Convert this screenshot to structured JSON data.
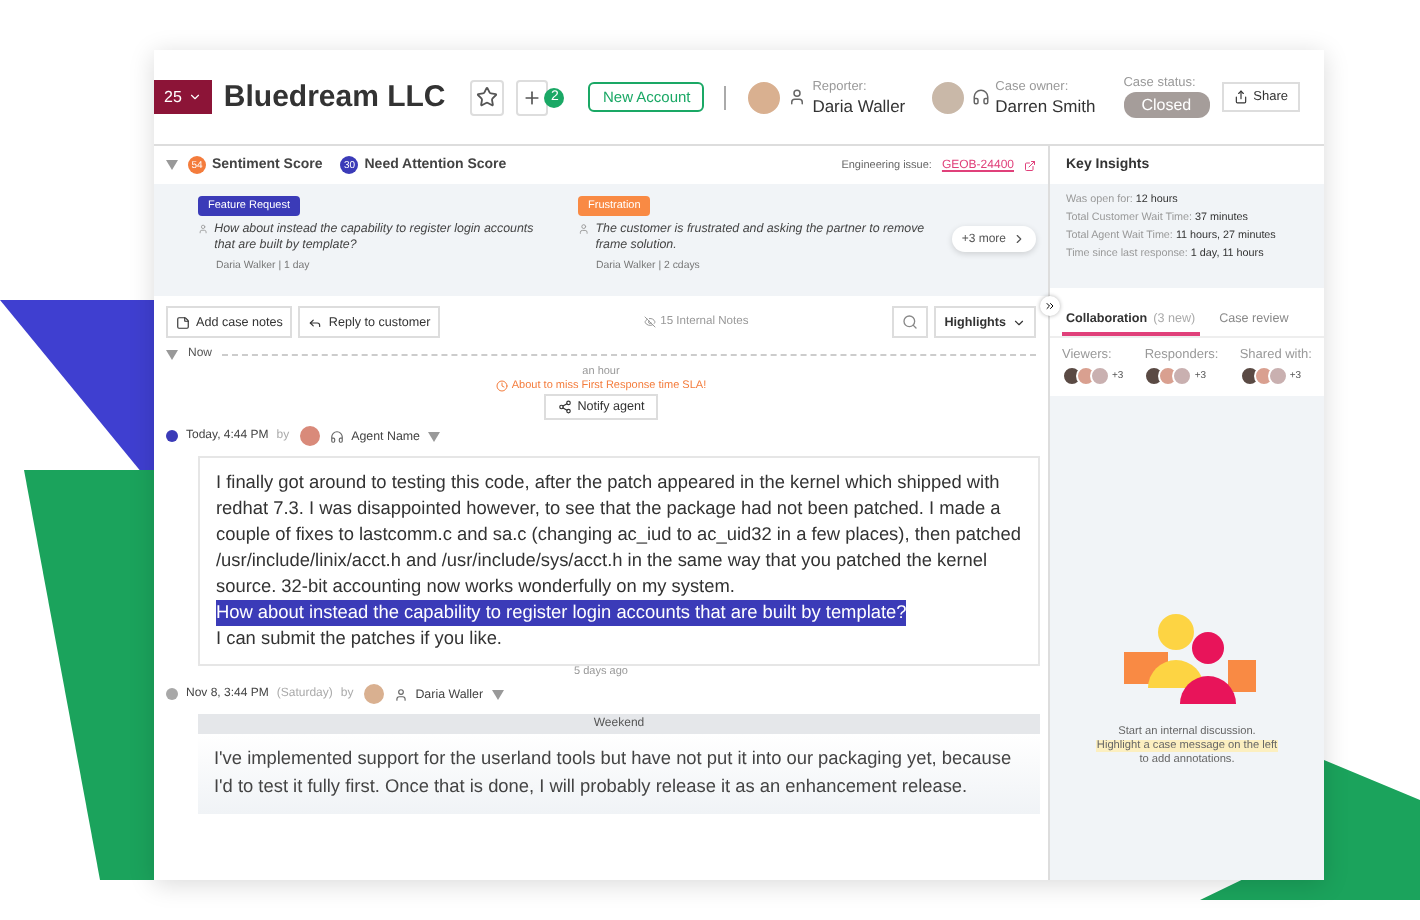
{
  "header": {
    "case_number": "25",
    "company": "Bluedream LLC",
    "linked_count": "2",
    "account_badge": "New Account",
    "reporter": {
      "label": "Reporter:",
      "name": "Daria Waller"
    },
    "owner": {
      "label": "Case owner:",
      "name": "Darren Smith"
    },
    "status": {
      "label": "Case status:",
      "value": "Closed"
    },
    "share": "Share"
  },
  "scores": [
    {
      "value": "54",
      "label": "Sentiment Score",
      "color": "#f47c3c"
    },
    {
      "value": "30",
      "label": "Need Attention Score",
      "color": "#3b3bb8"
    }
  ],
  "engineering_issue": {
    "label": "Engineering issue:",
    "link": "GEOB-24400"
  },
  "highlights": [
    {
      "tag": "Feature Request",
      "color": "#3b3bb8",
      "text": "How about instead the capability to register login accounts that are built by template?",
      "meta": "Daria Walker | 1 day"
    },
    {
      "tag": "Frustration",
      "color": "#f98a44",
      "text": "The customer is frustrated and asking the partner to remove frame solution.",
      "meta": "Daria Walker | 2 cdays"
    }
  ],
  "more": "+3 more",
  "toolbar": {
    "add_notes": "Add case notes",
    "reply": "Reply to customer",
    "internal_notes": "15 Internal Notes",
    "filter": "Highlights"
  },
  "timeline": {
    "now": "Now",
    "gap": "an hour",
    "sla": "About to miss First Response time SLA!",
    "notify": "Notify agent"
  },
  "messages": [
    {
      "time": "Today, 4:44 PM",
      "by": "by",
      "author": "Agent Name",
      "kind": "agent",
      "color": "#3b3bb8",
      "paragraphs": [
        {
          "text": "I finally got around to testing this code, after the patch appeared in the kernel which shipped with redhat 7.3. I was disappointed however, to see that the package had not been patched. I made a couple of fixes to lastcomm.c and sa.c (changing ac_iud to ac_uid32 in a few places), then patched /usr/include/linix/acct.h and /usr/include/sys/acct.h in the same way that you patched the kernel source. 32-bit accounting now works wonderfully on my system.",
          "highlighted": false
        },
        {
          "text": "How about instead the capability to register login accounts that are built by template?",
          "highlighted": true
        },
        {
          "text": "I can submit the patches if you like.",
          "highlighted": false
        }
      ]
    },
    {
      "gap": "5 days ago",
      "time": "Nov 8, 3:44 PM",
      "day": "(Saturday)",
      "by": "by",
      "author": "Daria Waller",
      "kind": "customer",
      "color": "#a8a8a8",
      "banner": "Weekend",
      "paragraphs": [
        {
          "text": "I've implemented support for the userland tools but have not put it into our packaging yet, because I'd to test it fully first. Once that is done, I will probably release it as an enhancement release.",
          "highlighted": false
        }
      ]
    }
  ],
  "key_insights": {
    "title": "Key Insights",
    "items": [
      {
        "label": "Was open for:",
        "value": "12 hours"
      },
      {
        "label": "Total Customer Wait Time:",
        "value": "37 minutes"
      },
      {
        "label": "Total Agent Wait Time:",
        "value": "11 hours, 27 minutes"
      },
      {
        "label": "Time since last response:",
        "value": "1 day, 11 hours"
      }
    ]
  },
  "collab_tabs": [
    {
      "label": "Collaboration",
      "count": "(3 new)",
      "selected": true
    },
    {
      "label": "Case review",
      "selected": false
    }
  ],
  "people_groups": [
    {
      "label": "Viewers:",
      "more": "+3"
    },
    {
      "label": "Responders:",
      "more": "+3"
    },
    {
      "label": "Shared with:",
      "more": "+3"
    }
  ],
  "empty_state": {
    "line1": "Start an internal discussion.",
    "highlight": "Highlight a case message on the left",
    "line2": "to add annotations."
  }
}
